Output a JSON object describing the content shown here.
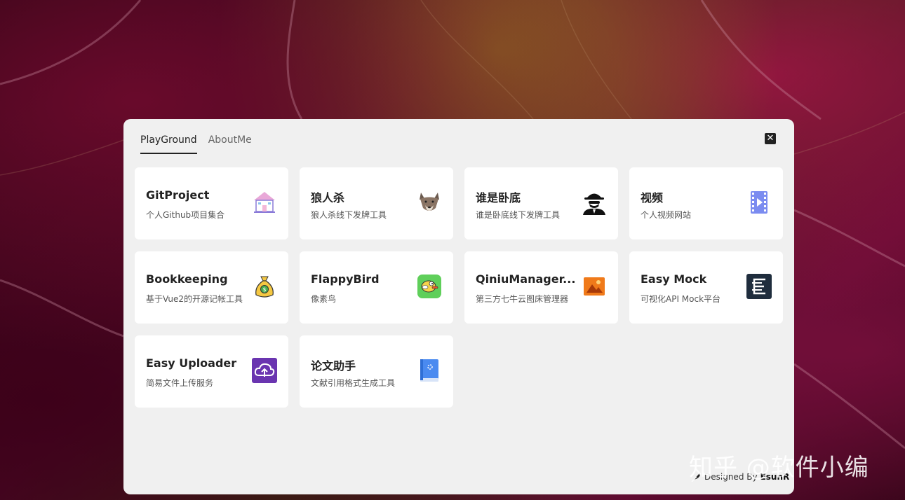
{
  "tabs": [
    {
      "label": "PlayGround",
      "active": true
    },
    {
      "label": "AboutMe",
      "active": false
    }
  ],
  "close_icon": "close-icon",
  "cards": [
    {
      "title": "GitProject",
      "desc": "个人Github项目集合",
      "icon": "house-icon"
    },
    {
      "title": "狼人杀",
      "desc": "狼人杀线下发牌工具",
      "icon": "wolf-icon"
    },
    {
      "title": "谁是卧底",
      "desc": "谁是卧底线下发牌工具",
      "icon": "spy-icon"
    },
    {
      "title": "视频",
      "desc": "个人视频网站",
      "icon": "video-icon"
    },
    {
      "title": "Bookkeeping",
      "desc": "基于Vue2的开源记帐工具",
      "icon": "money-bag-icon"
    },
    {
      "title": "FlappyBird",
      "desc": "像素鸟",
      "icon": "bird-icon"
    },
    {
      "title": "QiniuManager...",
      "desc": "第三方七牛云图床管理器",
      "icon": "image-icon"
    },
    {
      "title": "Easy Mock",
      "desc": "可视化API Mock平台",
      "icon": "easy-mock-icon"
    },
    {
      "title": "Easy Uploader",
      "desc": "简易文件上传服务",
      "icon": "cloud-upload-icon"
    },
    {
      "title": "论文助手",
      "desc": "文献引用格式生成工具",
      "icon": "book-icon"
    }
  ],
  "footer": {
    "prefix": "Designed By",
    "author": "EsunR"
  },
  "watermark": "知乎 @软件小编"
}
